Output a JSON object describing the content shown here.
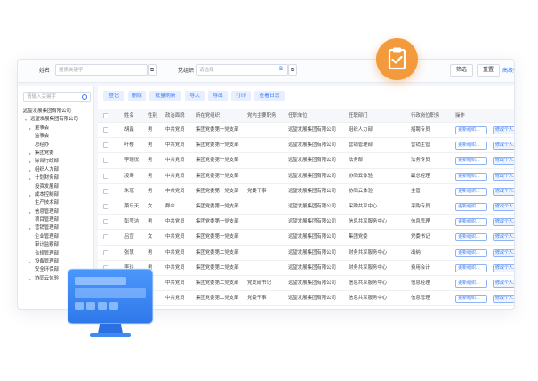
{
  "filter": {
    "name_label": "姓名",
    "name_placeholder": "搜索关键字",
    "org_label": "党组织",
    "org_placeholder": "请选择",
    "org_icon_text": "B",
    "filter_button": "筛选",
    "reset_button": "重置",
    "advanced_link": "高级筛选"
  },
  "sidebar": {
    "search_placeholder": "请输入关键字",
    "tree": [
      {
        "label": "远望发展集团有限公司",
        "level": 0,
        "arrow": "▸"
      },
      {
        "label": "远望发展集团有限公司",
        "level": 1,
        "arrow": "▾"
      },
      {
        "label": "董事会",
        "level": 2,
        "arrow": "▸"
      },
      {
        "label": "监事会",
        "level": 2,
        "arrow": ""
      },
      {
        "label": "总经办",
        "level": 2,
        "arrow": ""
      },
      {
        "label": "集团党委",
        "level": 2,
        "arrow": "▸"
      },
      {
        "label": "综合行政部",
        "level": 2,
        "arrow": "▸"
      },
      {
        "label": "组织人力部",
        "level": 2,
        "arrow": "▸"
      },
      {
        "label": "计划财务部",
        "level": 2,
        "arrow": "▸"
      },
      {
        "label": "投资发展部",
        "level": 2,
        "arrow": ""
      },
      {
        "label": "成本控制部",
        "level": 2,
        "arrow": "▸"
      },
      {
        "label": "生产技术部",
        "level": 2,
        "arrow": ""
      },
      {
        "label": "信息管理部",
        "level": 2,
        "arrow": "▸"
      },
      {
        "label": "项目管理部",
        "level": 2,
        "arrow": ""
      },
      {
        "label": "营销管理部",
        "level": 2,
        "arrow": "▸"
      },
      {
        "label": "企业管理部",
        "level": 2,
        "arrow": ""
      },
      {
        "label": "审计监察部",
        "level": 2,
        "arrow": ""
      },
      {
        "label": "合规管理部",
        "level": 2,
        "arrow": ""
      },
      {
        "label": "设备管理部",
        "level": 2,
        "arrow": "▸"
      },
      {
        "label": "安全环保部",
        "level": 2,
        "arrow": ""
      },
      {
        "label": "协同云体验",
        "level": 2,
        "arrow": "▸"
      }
    ]
  },
  "toolbar": {
    "buttons": [
      "登记",
      "删除",
      "批量刷新",
      "导入",
      "导出",
      "打印",
      "查看日志"
    ]
  },
  "table": {
    "columns": [
      "姓名",
      "性别",
      "政治面貌",
      "所在党组织",
      "党内主要职务",
      "任职单位",
      "任职部门",
      "行政岗位职务",
      "操作"
    ],
    "rows": [
      {
        "name": "胡鑫",
        "gender": "男",
        "political": "中共党员",
        "org": "集团党委第一党支部",
        "duty": "",
        "unit": "远望发展集团有限公司",
        "dept": "组织人力部",
        "post": "招聘专员",
        "act1": "更新组织...",
        "act2": "修改个人..."
      },
      {
        "name": "叶樱",
        "gender": "男",
        "political": "中共党员",
        "org": "集团党委第一党支部",
        "duty": "",
        "unit": "远望发展集团有限公司",
        "dept": "营销管理部",
        "post": "营销主管",
        "act1": "更新组织...",
        "act2": "修改个人..."
      },
      {
        "name": "李琬悦",
        "gender": "男",
        "political": "中共党员",
        "org": "集团党委第一党支部",
        "duty": "",
        "unit": "远望发展集团有限公司",
        "dept": "法务部",
        "post": "法务专员",
        "act1": "更新组织...",
        "act2": "修改个人..."
      },
      {
        "name": "凌寿",
        "gender": "男",
        "political": "中共党员",
        "org": "集团党委第一党支部",
        "duty": "",
        "unit": "远望发展集团有限公司",
        "dept": "协同云体验",
        "post": "副总经理",
        "act1": "更新组织...",
        "act2": "修改个人..."
      },
      {
        "name": "朱冠",
        "gender": "男",
        "political": "中共党员",
        "org": "集团党委第一党支部",
        "duty": "党委干事",
        "unit": "远望发展集团有限公司",
        "dept": "协同云体验",
        "post": "主管",
        "act1": "更新组织...",
        "act2": "修改个人..."
      },
      {
        "name": "萧乐天",
        "gender": "女",
        "political": "群众",
        "org": "集团党委第一党支部",
        "duty": "",
        "unit": "远望发展集团有限公司",
        "dept": "采购共享中心",
        "post": "采购专员",
        "act1": "更新组织...",
        "act2": "修改个人..."
      },
      {
        "name": "彭莹洁",
        "gender": "男",
        "political": "中共党员",
        "org": "集团党委第一党支部",
        "duty": "",
        "unit": "远望发展集团有限公司",
        "dept": "信息共享服务中心",
        "post": "信息管理",
        "act1": "更新组织...",
        "act2": "修改个人..."
      },
      {
        "name": "吕宣",
        "gender": "女",
        "political": "中共党员",
        "org": "集团党委第一党支部",
        "duty": "",
        "unit": "远望发展集团有限公司",
        "dept": "集团党委",
        "post": "党委书记",
        "act1": "更新组织...",
        "act2": "修改个人..."
      },
      {
        "name": "张慧",
        "gender": "男",
        "political": "中共党员",
        "org": "集团党委第二党支部",
        "duty": "",
        "unit": "远望发展集团有限公司",
        "dept": "财务共享服务中心",
        "post": "出纳",
        "act1": "更新组织...",
        "act2": "修改个人..."
      },
      {
        "name": "李玲",
        "gender": "男",
        "political": "中共党员",
        "org": "集团党委第二党支部",
        "duty": "",
        "unit": "远望发展集团有限公司",
        "dept": "财务共享服务中心",
        "post": "费用会计",
        "act1": "更新组织...",
        "act2": "修改个人..."
      },
      {
        "name": "",
        "gender": "",
        "political": "中共党员",
        "org": "集团党委第二党支部",
        "duty": "党支部书记",
        "unit": "远望发展集团有限公司",
        "dept": "信息共享服务中心",
        "post": "信息经理",
        "act1": "更新组织...",
        "act2": "修改个人..."
      },
      {
        "name": "",
        "gender": "",
        "political": "中共党员",
        "org": "集团党委第二党支部",
        "duty": "党委干事",
        "unit": "远望发展集团有限公司",
        "dept": "信息共享服务中心",
        "post": "信息管理",
        "act1": "更新组织...",
        "act2": "修改个人..."
      }
    ]
  },
  "colors": {
    "accent": "#3a7bf0",
    "badge": "#f39a3c",
    "monitor": "#3d8cf5"
  }
}
